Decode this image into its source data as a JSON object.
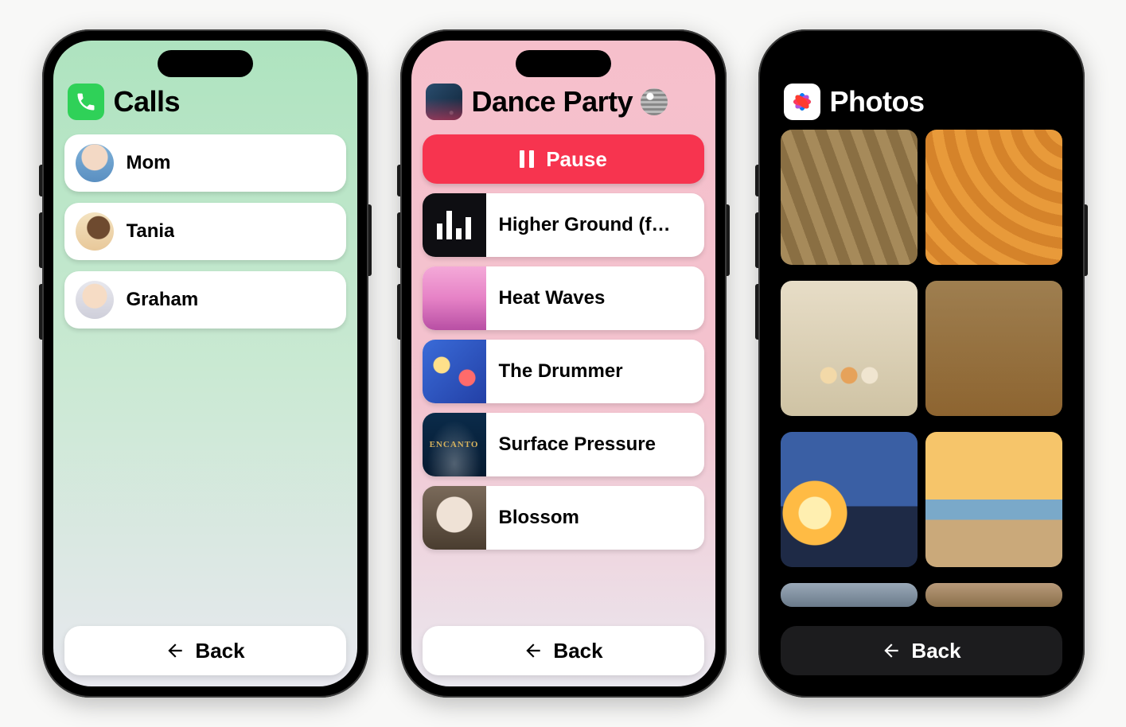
{
  "phones": {
    "calls": {
      "title": "Calls",
      "contacts": [
        {
          "name": "Mom"
        },
        {
          "name": "Tania"
        },
        {
          "name": "Graham"
        }
      ],
      "back_label": "Back"
    },
    "music": {
      "title": "Dance Party",
      "pause_label": "Pause",
      "encanto_label": "ENCANTO",
      "songs": [
        {
          "title": "Higher Ground (f…"
        },
        {
          "title": "Heat Waves"
        },
        {
          "title": "The Drummer"
        },
        {
          "title": "Surface Pressure"
        },
        {
          "title": "Blossom"
        }
      ],
      "back_label": "Back"
    },
    "photos": {
      "title": "Photos",
      "back_label": "Back"
    }
  }
}
